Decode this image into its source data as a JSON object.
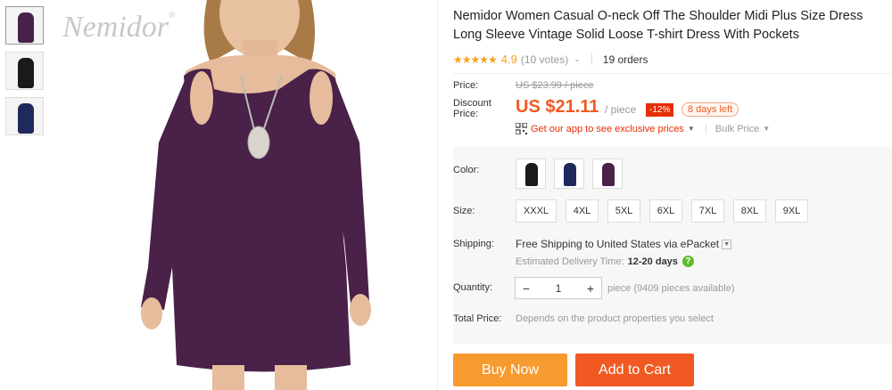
{
  "brand": {
    "logo_text": "Nemidor",
    "registered": "®"
  },
  "thumbnails": [
    {
      "color": "#4a2148",
      "active": true
    },
    {
      "color": "#1a1a1a",
      "active": false
    },
    {
      "color": "#1f2a5c",
      "active": false
    }
  ],
  "product": {
    "title": "Nemidor Women Casual O-neck Off The Shoulder Midi Plus Size Dress Long Sleeve Vintage Solid Loose T-shirt Dress With Pockets",
    "rating_stars": "★★★★★",
    "rating_value": "4.9",
    "votes": "(10 votes)",
    "orders": "19 orders"
  },
  "price": {
    "price_label": "Price:",
    "original": "US $23.99 / piece",
    "discount_label": "Discount Price:",
    "current": "US $21.11",
    "unit": "/ piece",
    "discount_badge": "-12%",
    "days_left": "8 days left",
    "app_promo": "Get our app to see exclusive prices",
    "bulk_price": "Bulk Price"
  },
  "options": {
    "color_label": "Color:",
    "colors": [
      {
        "name": "black",
        "hex": "#1a1a1a"
      },
      {
        "name": "navy",
        "hex": "#1f2a5c"
      },
      {
        "name": "purple",
        "hex": "#4a2148"
      }
    ],
    "size_label": "Size:",
    "sizes": [
      "XXXL",
      "4XL",
      "5XL",
      "6XL",
      "7XL",
      "8XL",
      "9XL"
    ]
  },
  "shipping": {
    "label": "Shipping:",
    "free": "Free Shipping",
    "to": "to",
    "destination": "United States via ePacket",
    "eta_label": "Estimated Delivery Time:",
    "eta_days": "12-20 days"
  },
  "quantity": {
    "label": "Quantity:",
    "value": "1",
    "minus": "−",
    "plus": "+",
    "note": "piece (9409 pieces available)"
  },
  "total": {
    "label": "Total Price:",
    "note": "Depends on the product properties you select"
  },
  "actions": {
    "buy_now": "Buy Now",
    "add_to_cart": "Add to Cart"
  },
  "colors_theme": {
    "accent": "#f05a22",
    "buy": "#f79a30",
    "star": "#f7a21b",
    "badge": "#e62e04"
  }
}
